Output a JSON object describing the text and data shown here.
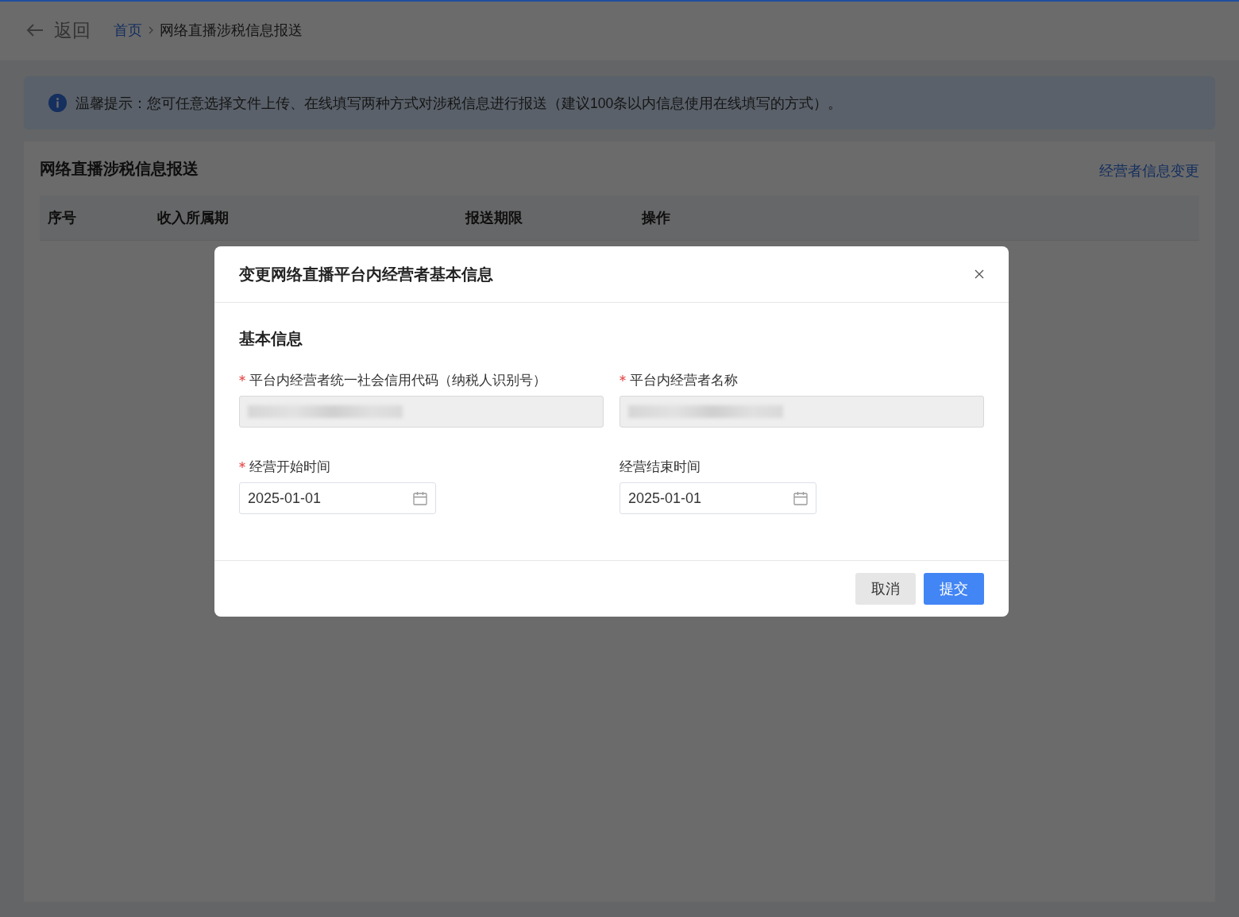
{
  "header": {
    "back_label": "返回",
    "breadcrumb": [
      {
        "label": "首页",
        "kind": "link"
      },
      {
        "label": "网络直播涉税信息报送",
        "kind": "current"
      }
    ]
  },
  "notice": {
    "text": "温馨提示：您可任意选择文件上传、在线填写两种方式对涉税信息进行报送（建议100条以内信息使用在线填写的方式）。"
  },
  "card": {
    "title": "网络直播涉税信息报送",
    "action_link": "经营者信息变更",
    "table": {
      "columns": [
        "序号",
        "收入所属期",
        "报送期限",
        "操作"
      ]
    }
  },
  "dialog": {
    "title": "变更网络直播平台内经营者基本信息",
    "section_title": "基本信息",
    "fields": [
      {
        "kind": "text",
        "label": "平台内经营者统一社会信用代码（纳税人识别号）",
        "required": true,
        "disabled": true,
        "redacted": true
      },
      {
        "kind": "text",
        "label": "平台内经营者名称",
        "required": true,
        "disabled": true,
        "redacted": true
      },
      {
        "kind": "date",
        "label": "经营开始时间",
        "required": true,
        "disabled": false,
        "value": "2025-01-01"
      },
      {
        "kind": "date",
        "label": "经营结束时间",
        "required": false,
        "disabled": false,
        "value": "2025-01-01"
      }
    ],
    "buttons": [
      {
        "label": "取消",
        "kind": "secondary"
      },
      {
        "label": "提交",
        "kind": "primary"
      }
    ]
  }
}
